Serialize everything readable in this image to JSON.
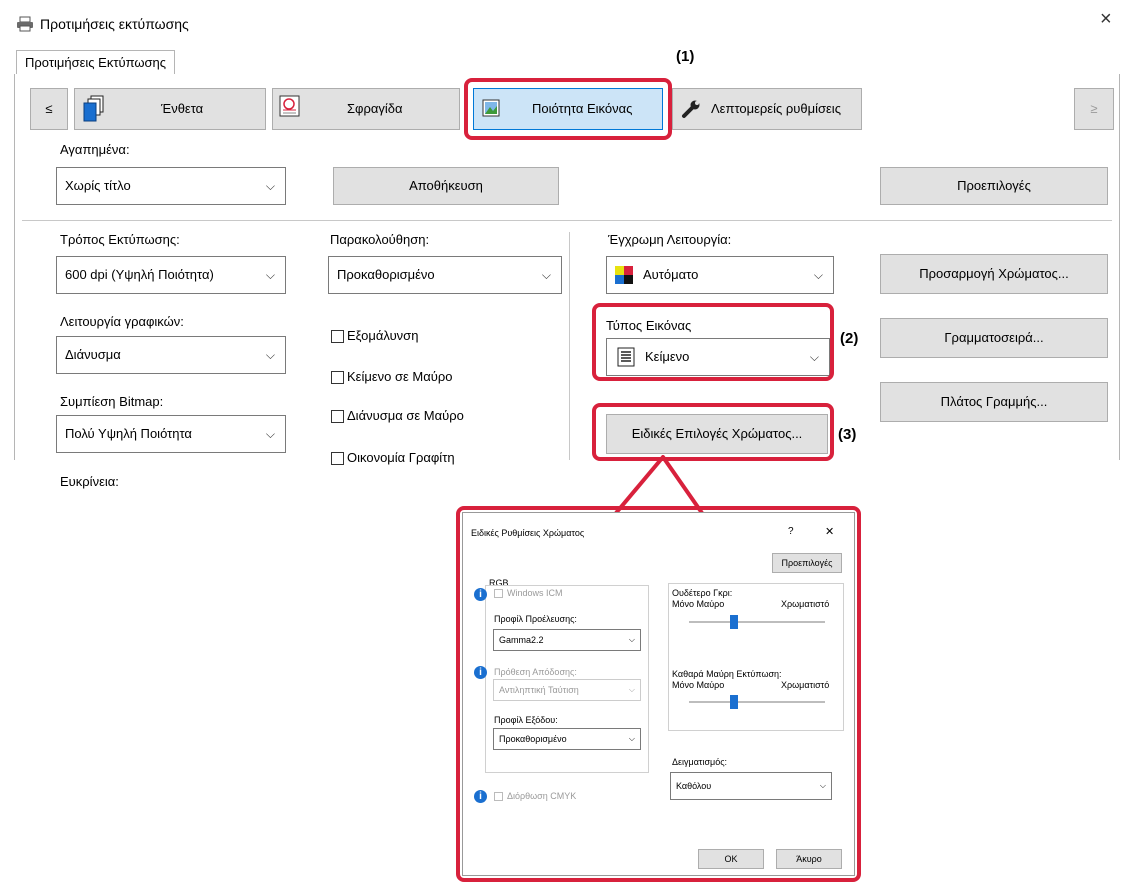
{
  "window": {
    "title": "Προτιμήσεις εκτύπωσης",
    "close": "×"
  },
  "tab": {
    "label": "Προτιμήσεις Εκτύπωσης"
  },
  "ribbon": {
    "prev": "≤",
    "next": "≥",
    "items": [
      "Ένθετα",
      "Σφραγίδα",
      "Ποιότητα Εικόνας",
      "Λεπτομερείς ρυθμίσεις"
    ]
  },
  "favorites": {
    "label": "Αγαπημένα:",
    "value": "Χωρίς τίτλο",
    "save": "Αποθήκευση",
    "defaults": "Προεπιλογές"
  },
  "print_mode": {
    "label": "Τρόπος Εκτύπωσης:",
    "value": "600 dpi (Υψηλή Ποιότητα)"
  },
  "monitoring": {
    "label": "Παρακολούθηση:",
    "value": "Προκαθορισμένο"
  },
  "color_mode": {
    "label": "Έγχρωμη Λειτουργία:",
    "value": "Αυτόματο"
  },
  "color_adjust": {
    "label": "Προσαρμογή Χρώματος..."
  },
  "graphics_mode": {
    "label": "Λειτουργία γραφικών:",
    "value": "Διάνυσμα"
  },
  "checkboxes": [
    "Εξομάλυνση",
    "Κείμενο σε Μαύρο",
    "Διάνυσμα σε Μαύρο",
    "Οικονομία Γραφίτη"
  ],
  "image_type": {
    "label": "Τύπος Εικόνας",
    "value": "Κείμενο"
  },
  "fonts": {
    "label": "Γραμματοσειρά..."
  },
  "bitmap": {
    "label": "Συμπίεση Bitmap:",
    "value": "Πολύ Υψηλή Ποιότητα"
  },
  "line_width": {
    "label": "Πλάτος Γραμμής..."
  },
  "special_color": {
    "label": "Ειδικές Επιλογές Χρώματος..."
  },
  "sharpness": {
    "label": "Ευκρίνεια:"
  },
  "callouts": [
    "(1)",
    "(2)",
    "(3)"
  ],
  "sub": {
    "title": "Ειδικές Ρυθμίσεις Χρώματος",
    "help": "?",
    "close": "✕",
    "defaults": "Προεπιλογές",
    "rgb": "RGB",
    "windows_icm": "Windows ICM",
    "source_profile": {
      "label": "Προφίλ Προέλευσης:",
      "value": "Gamma2.2"
    },
    "render_intent": {
      "label": "Πρόθεση Απόδοσης:",
      "value": "Αντιληπτική Ταύτιση"
    },
    "output_profile": {
      "label": "Προφίλ Εξόδου:",
      "value": "Προκαθορισμένο"
    },
    "cmyk": "Διόρθωση CMYK",
    "neutral_gray": {
      "label": "Ουδέτερο Γκρι:",
      "left": "Μόνο Μαύρο",
      "right": "Χρωματιστό"
    },
    "pure_black": {
      "label": "Καθαρά Μαύρη Εκτύπωση:",
      "left": "Μόνο Μαύρο",
      "right": "Χρωματιστό"
    },
    "sampling": {
      "label": "Δειγματισμός:",
      "value": "Καθόλου"
    },
    "ok": "OK",
    "cancel": "Άκυρο"
  },
  "colors": {
    "accent_red": "#d8213c",
    "blue": "#1a6fd0",
    "selected_tab_bg": "#cce4f7"
  }
}
